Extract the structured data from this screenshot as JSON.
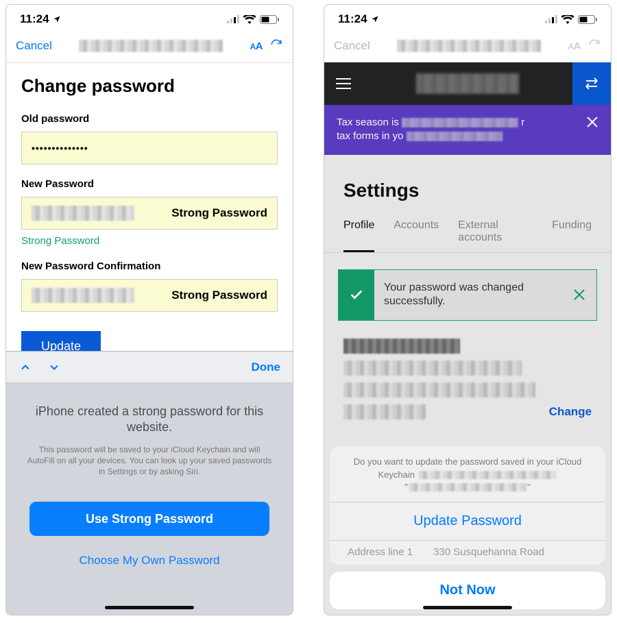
{
  "status": {
    "time": "11:24"
  },
  "nav": {
    "cancel": "Cancel",
    "aa": "AA"
  },
  "left": {
    "heading": "Change password",
    "old_label": "Old password",
    "old_value": "••••••••••••••",
    "new_label": "New Password",
    "strong_badge": "Strong Password",
    "hint": "Strong Password",
    "confirm_label": "New Password Confirmation",
    "update": "Update",
    "accessory": {
      "done": "Done"
    },
    "suggest": {
      "title": "iPhone created a strong password for this website.",
      "subtitle": "This password will be saved to your iCloud Keychain and will AutoFill on all your devices. You can look up your saved passwords in Settings or by asking Siri.",
      "primary": "Use Strong Password",
      "secondary": "Choose My Own Password"
    }
  },
  "right": {
    "banner": {
      "line1": "Tax season is",
      "line2_suffix": "r",
      "line3": "tax forms in yo"
    },
    "heading": "Settings",
    "tabs": {
      "profile": "Profile",
      "accounts": "Accounts",
      "external": "External accounts",
      "funding": "Funding"
    },
    "toast": "Your password was changed successfully.",
    "change": "Change",
    "ghost": {
      "label": "Address line 1",
      "value": "330 Susquehanna Road"
    },
    "sheet": {
      "message_prefix": "Do you want to update the password saved in your iCloud Keychain ",
      "update": "Update Password",
      "cancel": "Not Now"
    }
  }
}
